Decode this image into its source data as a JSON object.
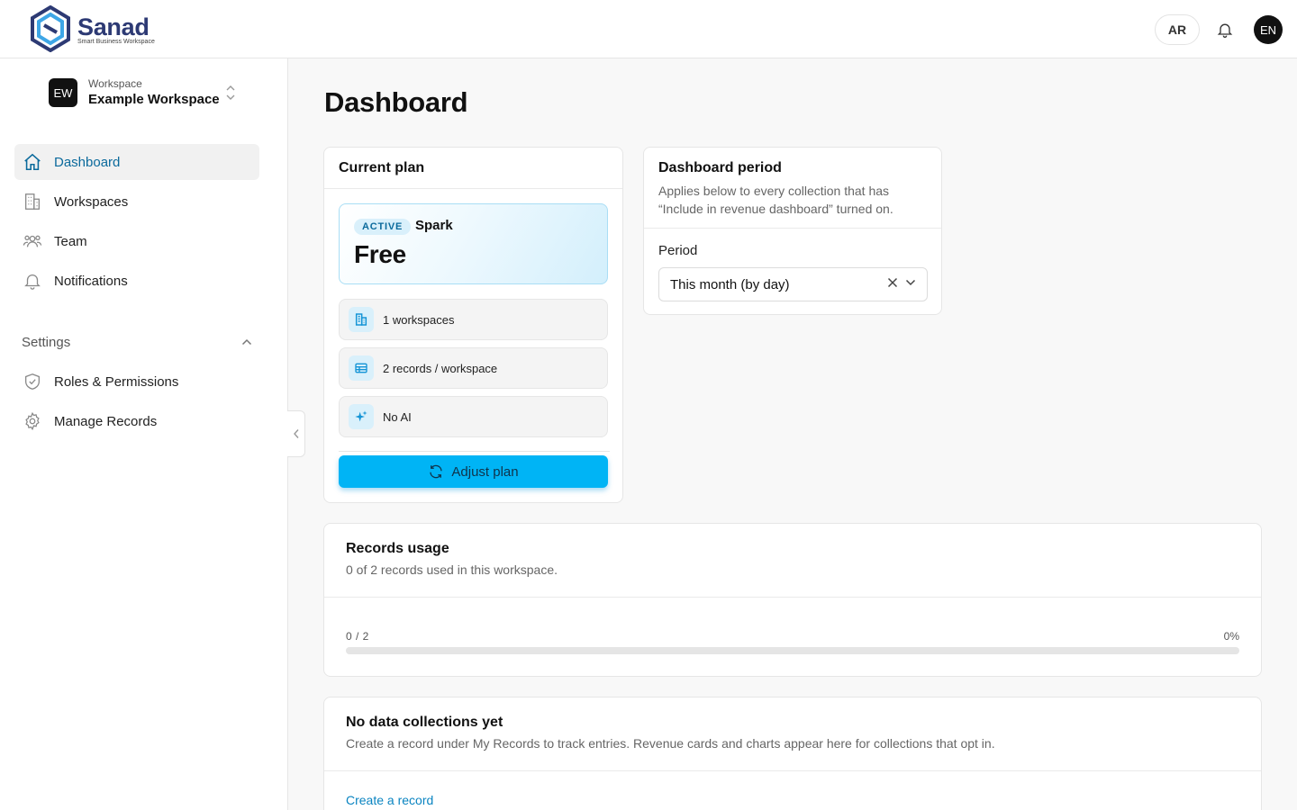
{
  "brand": {
    "name": "Sanad",
    "tagline": "Smart Business Workspace"
  },
  "header": {
    "lang_button": "AR",
    "user_initials": "EN"
  },
  "workspace": {
    "label": "Workspace",
    "name": "Example Workspace",
    "initials": "EW"
  },
  "nav": {
    "items": [
      {
        "label": "Dashboard",
        "icon": "home-icon",
        "active": true
      },
      {
        "label": "Workspaces",
        "icon": "building-icon"
      },
      {
        "label": "Team",
        "icon": "users-icon"
      },
      {
        "label": "Notifications",
        "icon": "bell-icon"
      }
    ],
    "settings_label": "Settings",
    "settings_items": [
      {
        "label": "Roles & Permissions",
        "icon": "shield-check-icon"
      },
      {
        "label": "Manage Records",
        "icon": "gear-icon"
      }
    ]
  },
  "page": {
    "title": "Dashboard"
  },
  "plan": {
    "card_title": "Current plan",
    "status": "ACTIVE",
    "name": "Spark",
    "price": "Free",
    "features": [
      {
        "label": "1 workspaces",
        "icon": "building-icon"
      },
      {
        "label": "2 records / workspace",
        "icon": "table-icon"
      },
      {
        "label": "No AI",
        "icon": "sparkles-icon"
      }
    ],
    "adjust_label": "Adjust plan"
  },
  "period": {
    "title": "Dashboard period",
    "description": "Applies below to every collection that has “Include in revenue dashboard” turned on.",
    "field_label": "Period",
    "selected": "This month (by day)"
  },
  "usage": {
    "title": "Records usage",
    "description": "0 of 2 records used in this workspace.",
    "count_text": "0 / 2",
    "percent_text": "0%",
    "used": 0,
    "limit": 2,
    "progress": 0
  },
  "collections": {
    "title": "No data collections yet",
    "description": "Create a record under My Records to track entries. Revenue cards and charts appear here for collections that opt in.",
    "link": "Create a record"
  },
  "colors": {
    "accent": "#00b4f5",
    "active_nav_text": "#0b6a9c",
    "brand_text": "#2d3a74"
  }
}
